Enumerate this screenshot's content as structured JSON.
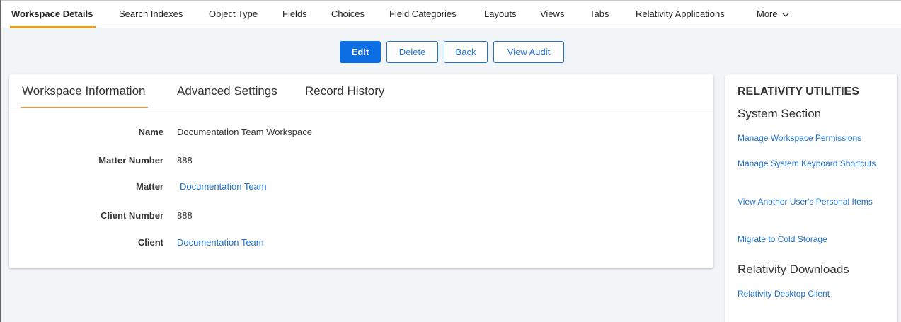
{
  "top_nav": {
    "items": [
      {
        "label": "Workspace Details",
        "active": true
      },
      {
        "label": "Search Indexes"
      },
      {
        "label": "Object Type"
      },
      {
        "label": "Fields"
      },
      {
        "label": "Choices"
      },
      {
        "label": "Field Categories"
      },
      {
        "label": "Layouts"
      },
      {
        "label": "Views"
      },
      {
        "label": "Tabs"
      },
      {
        "label": "Relativity Applications"
      },
      {
        "label": "More"
      }
    ],
    "more_icon": "chevron-down-icon"
  },
  "actions": {
    "edit_label": "Edit",
    "delete_label": "Delete",
    "back_label": "Back",
    "view_audit_label": "View Audit"
  },
  "card": {
    "tabs": [
      "Workspace Information",
      "Advanced Settings",
      "Record History"
    ],
    "active_tab": "Workspace Information",
    "fields": [
      {
        "label": "Name",
        "value": "Documentation Team Workspace",
        "is_link": false
      },
      {
        "label": "Matter Number",
        "value": "888",
        "is_link": false
      },
      {
        "label": "Matter",
        "value": "Documentation Team",
        "is_link": true
      },
      {
        "label": "Client Number",
        "value": "888",
        "is_link": false
      },
      {
        "label": "Client",
        "value": "Documentation Team",
        "is_link": true
      }
    ]
  },
  "utilities": {
    "title": "RELATIVITY UTILITIES",
    "system_section": {
      "title": "System Section",
      "links": [
        "Manage Workspace Permissions",
        "Manage System Keyboard Shortcuts",
        "View Another User's Personal Items",
        "Migrate to Cold Storage"
      ]
    },
    "downloads_section": {
      "title": "Relativity Downloads",
      "links": [
        "Relativity Desktop Client"
      ]
    }
  },
  "colors": {
    "accent": "#f39c12",
    "primary": "#0b6ee3",
    "link": "#1a6fd0",
    "page_bg": "#f2f5f8"
  }
}
